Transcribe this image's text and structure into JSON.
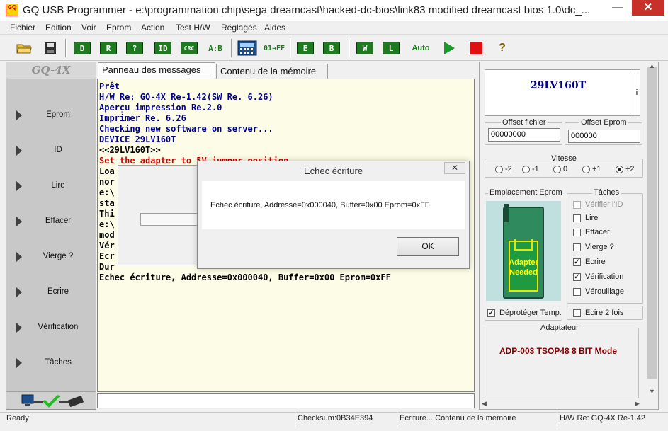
{
  "window": {
    "icon_text": "GQ",
    "title": "GQ USB Programmer - e:\\programmation chip\\sega dreamcast\\hacked-dc-bios\\link83 modified dreamcast bios 1.0\\dc_...",
    "minimize": "—",
    "close": "✕"
  },
  "menu": [
    "Fichier",
    "Edition",
    "Voir",
    "Eprom",
    "Action",
    "Test H/W",
    "Réglages",
    "Aides"
  ],
  "toolbar": {
    "erase_label": "A:B",
    "hex_label": "01→FF",
    "auto_label": "Auto",
    "help_label": "?"
  },
  "left_panel": {
    "logo": "GQ-4X",
    "items": [
      "Eprom",
      "ID",
      "Lire",
      "Effacer",
      "Vierge ?",
      "Ecrire",
      "Vérification",
      "Tâches"
    ]
  },
  "tabs": [
    "Panneau des messages",
    "Contenu de la mémoire"
  ],
  "messages": [
    {
      "text": "Prêt",
      "color": "#000090"
    },
    {
      "text": "H/W Re: GQ-4X Re-1.42(SW Re. 6.26)",
      "color": "#000090"
    },
    {
      "text": "Aperçu impression Re.2.0",
      "color": "#000090"
    },
    {
      "text": "Imprimer Re. 6.26",
      "color": "#000090"
    },
    {
      "text": "Checking new software on server...",
      "color": "#000090"
    },
    {
      "text": "DEVICE 29LV160T",
      "color": "#000090"
    },
    {
      "text": "<<29LV160T>>",
      "color": "#000000"
    },
    {
      "text": "Set the adapter to 5V jumper position",
      "color": "#d00000"
    },
    {
      "text": "Loa",
      "color": "#000000"
    },
    {
      "text": "nor",
      "color": "#000000"
    },
    {
      "text": "e:\\",
      "color": "#000000"
    },
    {
      "text": "sta",
      "color": "#000000"
    },
    {
      "text": "Thi",
      "color": "#000000"
    },
    {
      "text": "e:\\",
      "color": "#000000"
    },
    {
      "text": "mod",
      "color": "#000000"
    },
    {
      "text": "Vér",
      "color": "#000000"
    },
    {
      "text": "Ecr",
      "color": "#000000"
    },
    {
      "text": "Dur",
      "color": "#000000"
    },
    {
      "text": "Echec écriture, Addresse=0x000040, Buffer=0x00 Eprom=0xFF",
      "color": "#000000"
    }
  ],
  "right_panel": {
    "chip_name": "29LV160T",
    "info_btn": "i",
    "offset_file_label": "Offset fichier",
    "offset_file_value": "00000000",
    "offset_eprom_label": "Offset Eprom",
    "offset_eprom_value": "000000",
    "speed_label": "Vitesse",
    "speeds": [
      {
        "label": "-2",
        "selected": false
      },
      {
        "label": "-1",
        "selected": false
      },
      {
        "label": "0",
        "selected": false
      },
      {
        "label": "+1",
        "selected": false
      },
      {
        "label": "+2",
        "selected": true
      }
    ],
    "socket_label": "Emplacement Eprom",
    "socket_text_1": "Adapter",
    "socket_text_2": "Needed",
    "unprotect_label": "Déprotéger Temp.",
    "tasks_label": "Tâches",
    "tasks": [
      {
        "label": "Vérifier l'ID",
        "checked": false,
        "disabled": true
      },
      {
        "label": "Lire",
        "checked": false,
        "disabled": false
      },
      {
        "label": "Effacer",
        "checked": false,
        "disabled": false
      },
      {
        "label": "Vierge ?",
        "checked": false,
        "disabled": false
      },
      {
        "label": "Ecrire",
        "checked": true,
        "disabled": false
      },
      {
        "label": "Vérification",
        "checked": true,
        "disabled": false
      },
      {
        "label": "Vérouillage",
        "checked": false,
        "disabled": false
      }
    ],
    "write_twice_label": "Ecire 2 fois",
    "adapter_label": "Adaptateur",
    "adapter_name": "ADP-003 TSOP48 8 BIT Mode"
  },
  "statusbar": {
    "ready": "Ready",
    "checksum": "Checksum:0B34E394",
    "action": "Ecriture... Contenu de la mémoire",
    "hw": "H/W Re: GQ-4X Re-1.42"
  },
  "dialog": {
    "title": "Echec écriture",
    "message": "Echec écriture, Addresse=0x000040, Buffer=0x00 Eprom=0xFF",
    "ok": "OK",
    "close": "✕"
  },
  "colors": {
    "message_blue": "#000090",
    "warning_red": "#d00000",
    "adapter_red": "#800000",
    "chip_green": "#2f8a5e"
  }
}
